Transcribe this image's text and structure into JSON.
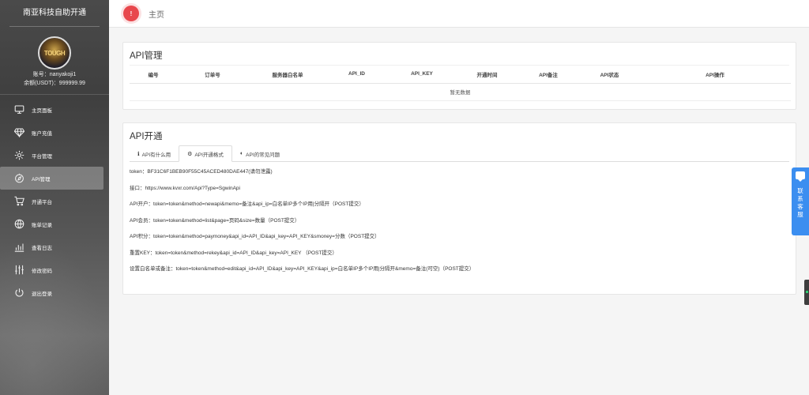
{
  "sidebar": {
    "brand": "南亚科技自助开通",
    "avatar_text": "TOUGH",
    "account_line": "账号：nanyakoji1",
    "balance_line": "余额(USDT)：999999.99",
    "items": [
      {
        "label": "主页面板",
        "icon": "monitor-icon"
      },
      {
        "label": "账户充值",
        "icon": "diamond-icon"
      },
      {
        "label": "平台管理",
        "icon": "gear-icon"
      },
      {
        "label": "API管理",
        "icon": "compass-icon"
      },
      {
        "label": "开通平台",
        "icon": "cart-icon"
      },
      {
        "label": "账单记录",
        "icon": "globe-icon"
      },
      {
        "label": "查看日志",
        "icon": "bar-chart-icon"
      },
      {
        "label": "修改密码",
        "icon": "sliders-icon"
      },
      {
        "label": "退出登录",
        "icon": "power-icon"
      }
    ],
    "active_index": 3
  },
  "header": {
    "badge": "!",
    "title": "主页"
  },
  "api_manage": {
    "title": "API管理",
    "columns": [
      "编号",
      "订单号",
      "服务器白名单",
      "API_ID",
      "API_KEY",
      "开通时间",
      "API备注",
      "API状态",
      "API操作"
    ],
    "empty_text": "暂无数据"
  },
  "api_open": {
    "title": "API开通",
    "tabs": [
      {
        "icon": "ℹ",
        "label": "API有什么用"
      },
      {
        "icon": "⚙",
        "label": "API开通格式"
      },
      {
        "icon": "◐",
        "label": "API的常见问题"
      }
    ],
    "active_tab": 1,
    "lines": [
      "token：BF31C6F1BEB90F55C45ACED480DAE447(请勿泄露)",
      "接口：https://www.kvxr.com/Api?Type=SgwinApi",
      "API开户：token=token&method=newapi&memo=备注&api_ip=白名单IP多个IP用|分隔开（POST提交）",
      "API会员：token=token&method=list&page=页码&size=数量（POST提交）",
      "API积分：token=token&method=paymoney&api_id=API_ID&api_key=API_KEY&smoney=分数（POST提交）",
      "重置KEY：token=token&method=rekey&api_id=API_ID&api_key=API_KEY （POST提交）",
      "设置白名单或备注：token=token&method=edit&api_id=API_ID&api_key=API_KEY&api_ip=白名单IP多个IP用|分隔开&memo=备注(可空)（POST提交）"
    ]
  },
  "contact": {
    "label": "联系客服"
  },
  "colors": {
    "accent_red": "#e8474c",
    "contact_blue": "#3b8ef0"
  }
}
